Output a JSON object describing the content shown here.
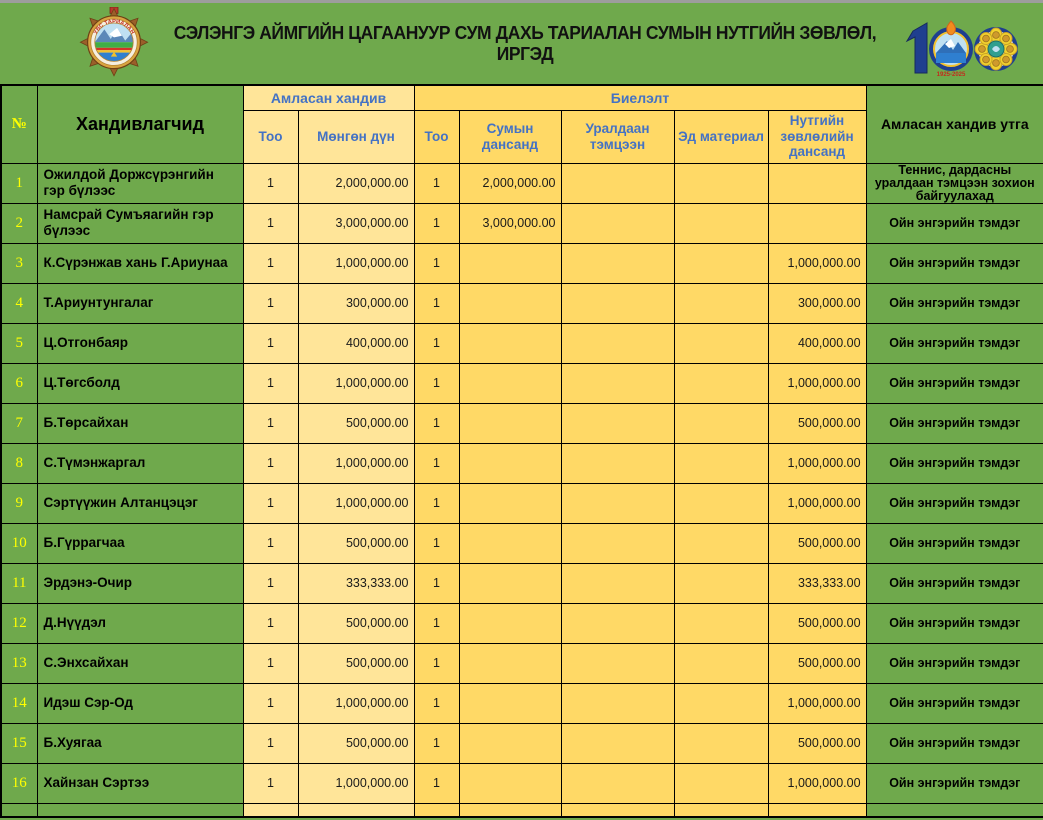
{
  "header": {
    "title": "СЭЛЭНГЭ АЙМГИЙН ЦАГААНУУР СУМ ДАХЬ ТАРИАЛАН СУМЫН НУТГИЙН ЗӨВЛӨЛ, ИРГЭД",
    "left_emblem": {
      "name": "tarialan-sum-crest",
      "arc_text": "УВС ТАРИАЛАН"
    },
    "right_emblem": {
      "name": "100-years-anniversary-emblem",
      "years": "1925-2025"
    }
  },
  "colors": {
    "page_green": "#6fa94c",
    "pledged_yellow": "#ffe599",
    "fulfillment_gold": "#ffd966",
    "header_blue": "#4472c4",
    "row_number_yellow": "#ffff00"
  },
  "table": {
    "headers": {
      "no": "№",
      "donors": "Хандивлагчид",
      "pledged_group": "Амласан хандив",
      "fulfillment_group": "Биелэлт",
      "pledged_count": "Тоо",
      "pledged_amount": "Мөнгөн дүн",
      "fulfilled_count": "Тоо",
      "sum_account": "Сумын дансанд",
      "competition": "Уралдаан тэмцээн",
      "materials": "Эд материал",
      "council_account": "Нутгийн зөвлөлийн дансанд",
      "note": "Амласан хандив утга"
    },
    "rows": [
      {
        "no": "1",
        "name": "Ожилдой Доржсүрэнгийн гэр бүлээс",
        "pledged_count": "1",
        "pledged_amount": "2,000,000.00",
        "fulfilled_count": "1",
        "sum_account": "2,000,000.00",
        "competition": "",
        "materials": "",
        "council_account": "",
        "note": "Теннис, дардасны уралдаан тэмцээн зохион байгуулахад"
      },
      {
        "no": "2",
        "name": "Намсрай Сумъяагийн гэр бүлээс",
        "pledged_count": "1",
        "pledged_amount": "3,000,000.00",
        "fulfilled_count": "1",
        "sum_account": "3,000,000.00",
        "competition": "",
        "materials": "",
        "council_account": "",
        "note": "Ойн энгэрийн тэмдэг"
      },
      {
        "no": "3",
        "name": "К.Сүрэнжав хань Г.Ариунаа",
        "pledged_count": "1",
        "pledged_amount": "1,000,000.00",
        "fulfilled_count": "1",
        "sum_account": "",
        "competition": "",
        "materials": "",
        "council_account": "1,000,000.00",
        "note": "Ойн энгэрийн тэмдэг"
      },
      {
        "no": "4",
        "name": "Т.Ариунтунгалаг",
        "pledged_count": "1",
        "pledged_amount": "300,000.00",
        "fulfilled_count": "1",
        "sum_account": "",
        "competition": "",
        "materials": "",
        "council_account": "300,000.00",
        "note": "Ойн энгэрийн тэмдэг"
      },
      {
        "no": "5",
        "name": "Ц.Отгонбаяр",
        "pledged_count": "1",
        "pledged_amount": "400,000.00",
        "fulfilled_count": "1",
        "sum_account": "",
        "competition": "",
        "materials": "",
        "council_account": "400,000.00",
        "note": "Ойн энгэрийн тэмдэг"
      },
      {
        "no": "6",
        "name": "Ц.Төгсболд",
        "pledged_count": "1",
        "pledged_amount": "1,000,000.00",
        "fulfilled_count": "1",
        "sum_account": "",
        "competition": "",
        "materials": "",
        "council_account": "1,000,000.00",
        "note": "Ойн энгэрийн тэмдэг"
      },
      {
        "no": "7",
        "name": "Б.Төрсайхан",
        "pledged_count": "1",
        "pledged_amount": "500,000.00",
        "fulfilled_count": "1",
        "sum_account": "",
        "competition": "",
        "materials": "",
        "council_account": "500,000.00",
        "note": "Ойн энгэрийн тэмдэг"
      },
      {
        "no": "8",
        "name": "С.Түмэнжаргал",
        "pledged_count": "1",
        "pledged_amount": "1,000,000.00",
        "fulfilled_count": "1",
        "sum_account": "",
        "competition": "",
        "materials": "",
        "council_account": "1,000,000.00",
        "note": "Ойн энгэрийн тэмдэг"
      },
      {
        "no": "9",
        "name": "Сэртүүжин Алтанцэцэг",
        "pledged_count": "1",
        "pledged_amount": "1,000,000.00",
        "fulfilled_count": "1",
        "sum_account": "",
        "competition": "",
        "materials": "",
        "council_account": "1,000,000.00",
        "note": "Ойн энгэрийн тэмдэг"
      },
      {
        "no": "10",
        "name": "Б.Гүррагчаа",
        "pledged_count": "1",
        "pledged_amount": "500,000.00",
        "fulfilled_count": "1",
        "sum_account": "",
        "competition": "",
        "materials": "",
        "council_account": "500,000.00",
        "note": "Ойн энгэрийн тэмдэг"
      },
      {
        "no": "11",
        "name": "Эрдэнэ-Очир",
        "pledged_count": "1",
        "pledged_amount": "333,333.00",
        "fulfilled_count": "1",
        "sum_account": "",
        "competition": "",
        "materials": "",
        "council_account": "333,333.00",
        "note": "Ойн энгэрийн тэмдэг"
      },
      {
        "no": "12",
        "name": "Д.Нүүдэл",
        "pledged_count": "1",
        "pledged_amount": "500,000.00",
        "fulfilled_count": "1",
        "sum_account": "",
        "competition": "",
        "materials": "",
        "council_account": "500,000.00",
        "note": "Ойн энгэрийн тэмдэг"
      },
      {
        "no": "13",
        "name": "С.Энхсайхан",
        "pledged_count": "1",
        "pledged_amount": "500,000.00",
        "fulfilled_count": "1",
        "sum_account": "",
        "competition": "",
        "materials": "",
        "council_account": "500,000.00",
        "note": "Ойн энгэрийн тэмдэг"
      },
      {
        "no": "14",
        "name": "Идэш Сэр-Од",
        "pledged_count": "1",
        "pledged_amount": "1,000,000.00",
        "fulfilled_count": "1",
        "sum_account": "",
        "competition": "",
        "materials": "",
        "council_account": "1,000,000.00",
        "note": "Ойн энгэрийн тэмдэг"
      },
      {
        "no": "15",
        "name": "Б.Хуягаа",
        "pledged_count": "1",
        "pledged_amount": "500,000.00",
        "fulfilled_count": "1",
        "sum_account": "",
        "competition": "",
        "materials": "",
        "council_account": "500,000.00",
        "note": "Ойн энгэрийн тэмдэг"
      },
      {
        "no": "16",
        "name": "Хайнзан Сэртээ",
        "pledged_count": "1",
        "pledged_amount": "1,000,000.00",
        "fulfilled_count": "1",
        "sum_account": "",
        "competition": "",
        "materials": "",
        "council_account": "1,000,000.00",
        "note": "Ойн энгэрийн тэмдэг"
      }
    ]
  }
}
